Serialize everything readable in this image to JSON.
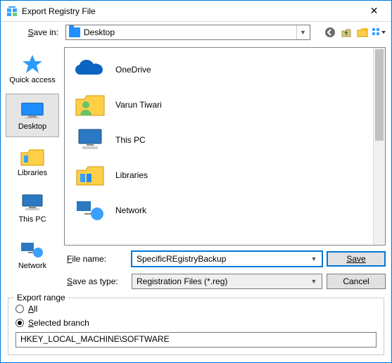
{
  "window": {
    "title": "Export Registry File",
    "close_symbol": "✕"
  },
  "topbar": {
    "save_in_label": "Save in:",
    "selected_location": "Desktop",
    "icons": {
      "back": "back-icon",
      "up": "up-one-level-icon",
      "newfolder": "new-folder-icon",
      "view": "view-menu-icon"
    }
  },
  "places": [
    {
      "key": "quick-access",
      "label": "Quick access"
    },
    {
      "key": "desktop",
      "label": "Desktop"
    },
    {
      "key": "libraries",
      "label": "Libraries"
    },
    {
      "key": "this-pc",
      "label": "This PC"
    },
    {
      "key": "network",
      "label": "Network"
    }
  ],
  "selected_place": "desktop",
  "file_list": [
    {
      "label": "OneDrive",
      "icon": "onedrive-icon"
    },
    {
      "label": "Varun Tiwari",
      "icon": "user-folder-icon"
    },
    {
      "label": "This PC",
      "icon": "pc-icon"
    },
    {
      "label": "Libraries",
      "icon": "libraries-icon"
    },
    {
      "label": "Network",
      "icon": "network-icon"
    }
  ],
  "controls": {
    "filename_label": "File name:",
    "filename_value": "SpecificREgistryBackup",
    "type_label": "Save as type:",
    "type_value": "Registration Files (*.reg)",
    "save_label": "Save",
    "cancel_label": "Cancel"
  },
  "export_range": {
    "legend": "Export range",
    "all_label": "All",
    "selected_label": "Selected branch",
    "selection": "selected",
    "branch_value": "HKEY_LOCAL_MACHINE\\SOFTWARE"
  }
}
